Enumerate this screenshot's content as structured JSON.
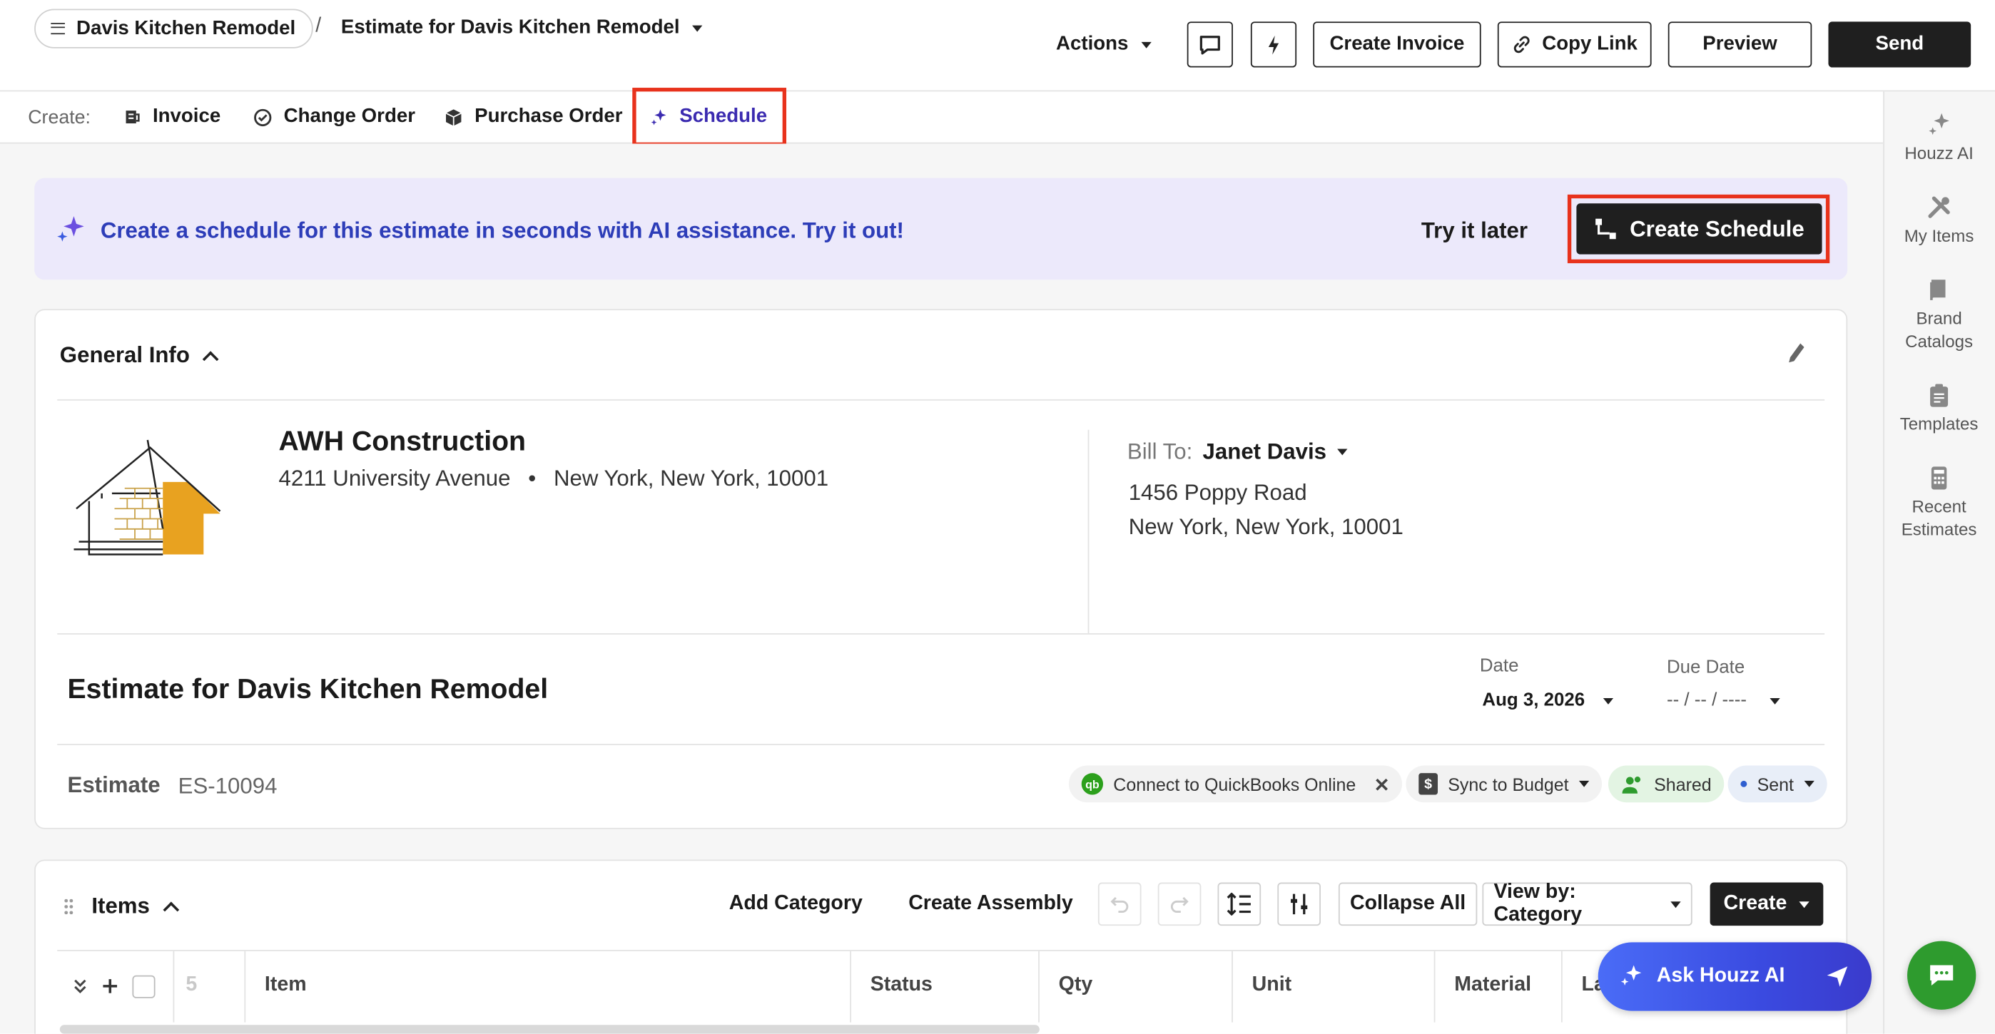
{
  "header": {
    "project_name": "Davis Kitchen Remodel",
    "separator": "/",
    "document_title": "Estimate for Davis Kitchen Remodel",
    "actions_label": "Actions",
    "create_invoice": "Create Invoice",
    "copy_link": "Copy Link",
    "preview": "Preview",
    "send": "Send"
  },
  "create_bar": {
    "label": "Create:",
    "items": [
      "Invoice",
      "Change Order",
      "Purchase Order",
      "Schedule"
    ],
    "active": "Schedule"
  },
  "banner": {
    "text": "Create a schedule for this estimate in seconds with AI assistance. Try it out!",
    "try_later": "Try it later",
    "create_schedule": "Create Schedule"
  },
  "general_info": {
    "title": "General Info",
    "company": {
      "name": "AWH Construction",
      "street": "4211 University Avenue",
      "bullet": "•",
      "city": "New York, New York, 10001"
    },
    "bill_to": {
      "label": "Bill To:",
      "name": "Janet Davis",
      "line1": "1456 Poppy Road",
      "line2": "New York, New York, 10001"
    },
    "estimate_title": "Estimate for Davis Kitchen Remodel",
    "date_label": "Date",
    "date_value": "Aug 3, 2026",
    "due_date_label": "Due Date",
    "due_date_value": "-- / -- / ----",
    "estimate_label": "Estimate",
    "estimate_number": "ES-10094",
    "chips": {
      "quickbooks": "Connect to QuickBooks Online",
      "sync_budget": "Sync to Budget",
      "shared": "Shared",
      "sent": "Sent"
    }
  },
  "items": {
    "title": "Items",
    "add_category": "Add Category",
    "create_assembly": "Create Assembly",
    "collapse_all": "Collapse All",
    "view_by": "View by: Category",
    "create": "Create",
    "columns": {
      "count": "5",
      "item": "Item",
      "status": "Status",
      "qty": "Qty",
      "unit": "Unit",
      "material": "Material",
      "labor": "La"
    }
  },
  "right_sidebar": {
    "items": [
      {
        "label": "Houzz AI",
        "icon": "sparkle-icon"
      },
      {
        "label": "My Items",
        "icon": "tools-icon"
      },
      {
        "label": "Brand Catalogs",
        "icon": "book-icon"
      },
      {
        "label": "Templates",
        "icon": "clipboard-icon"
      },
      {
        "label": "Recent Estimates",
        "icon": "calculator-icon"
      }
    ]
  },
  "floating": {
    "ask_ai": "Ask Houzz AI"
  },
  "colors": {
    "accent_purple": "#3b2bb0",
    "banner_bg": "#ece9fb",
    "banner_text": "#2d3db8",
    "highlight_red": "#e8321c",
    "chat_green": "#2e9b2e"
  }
}
